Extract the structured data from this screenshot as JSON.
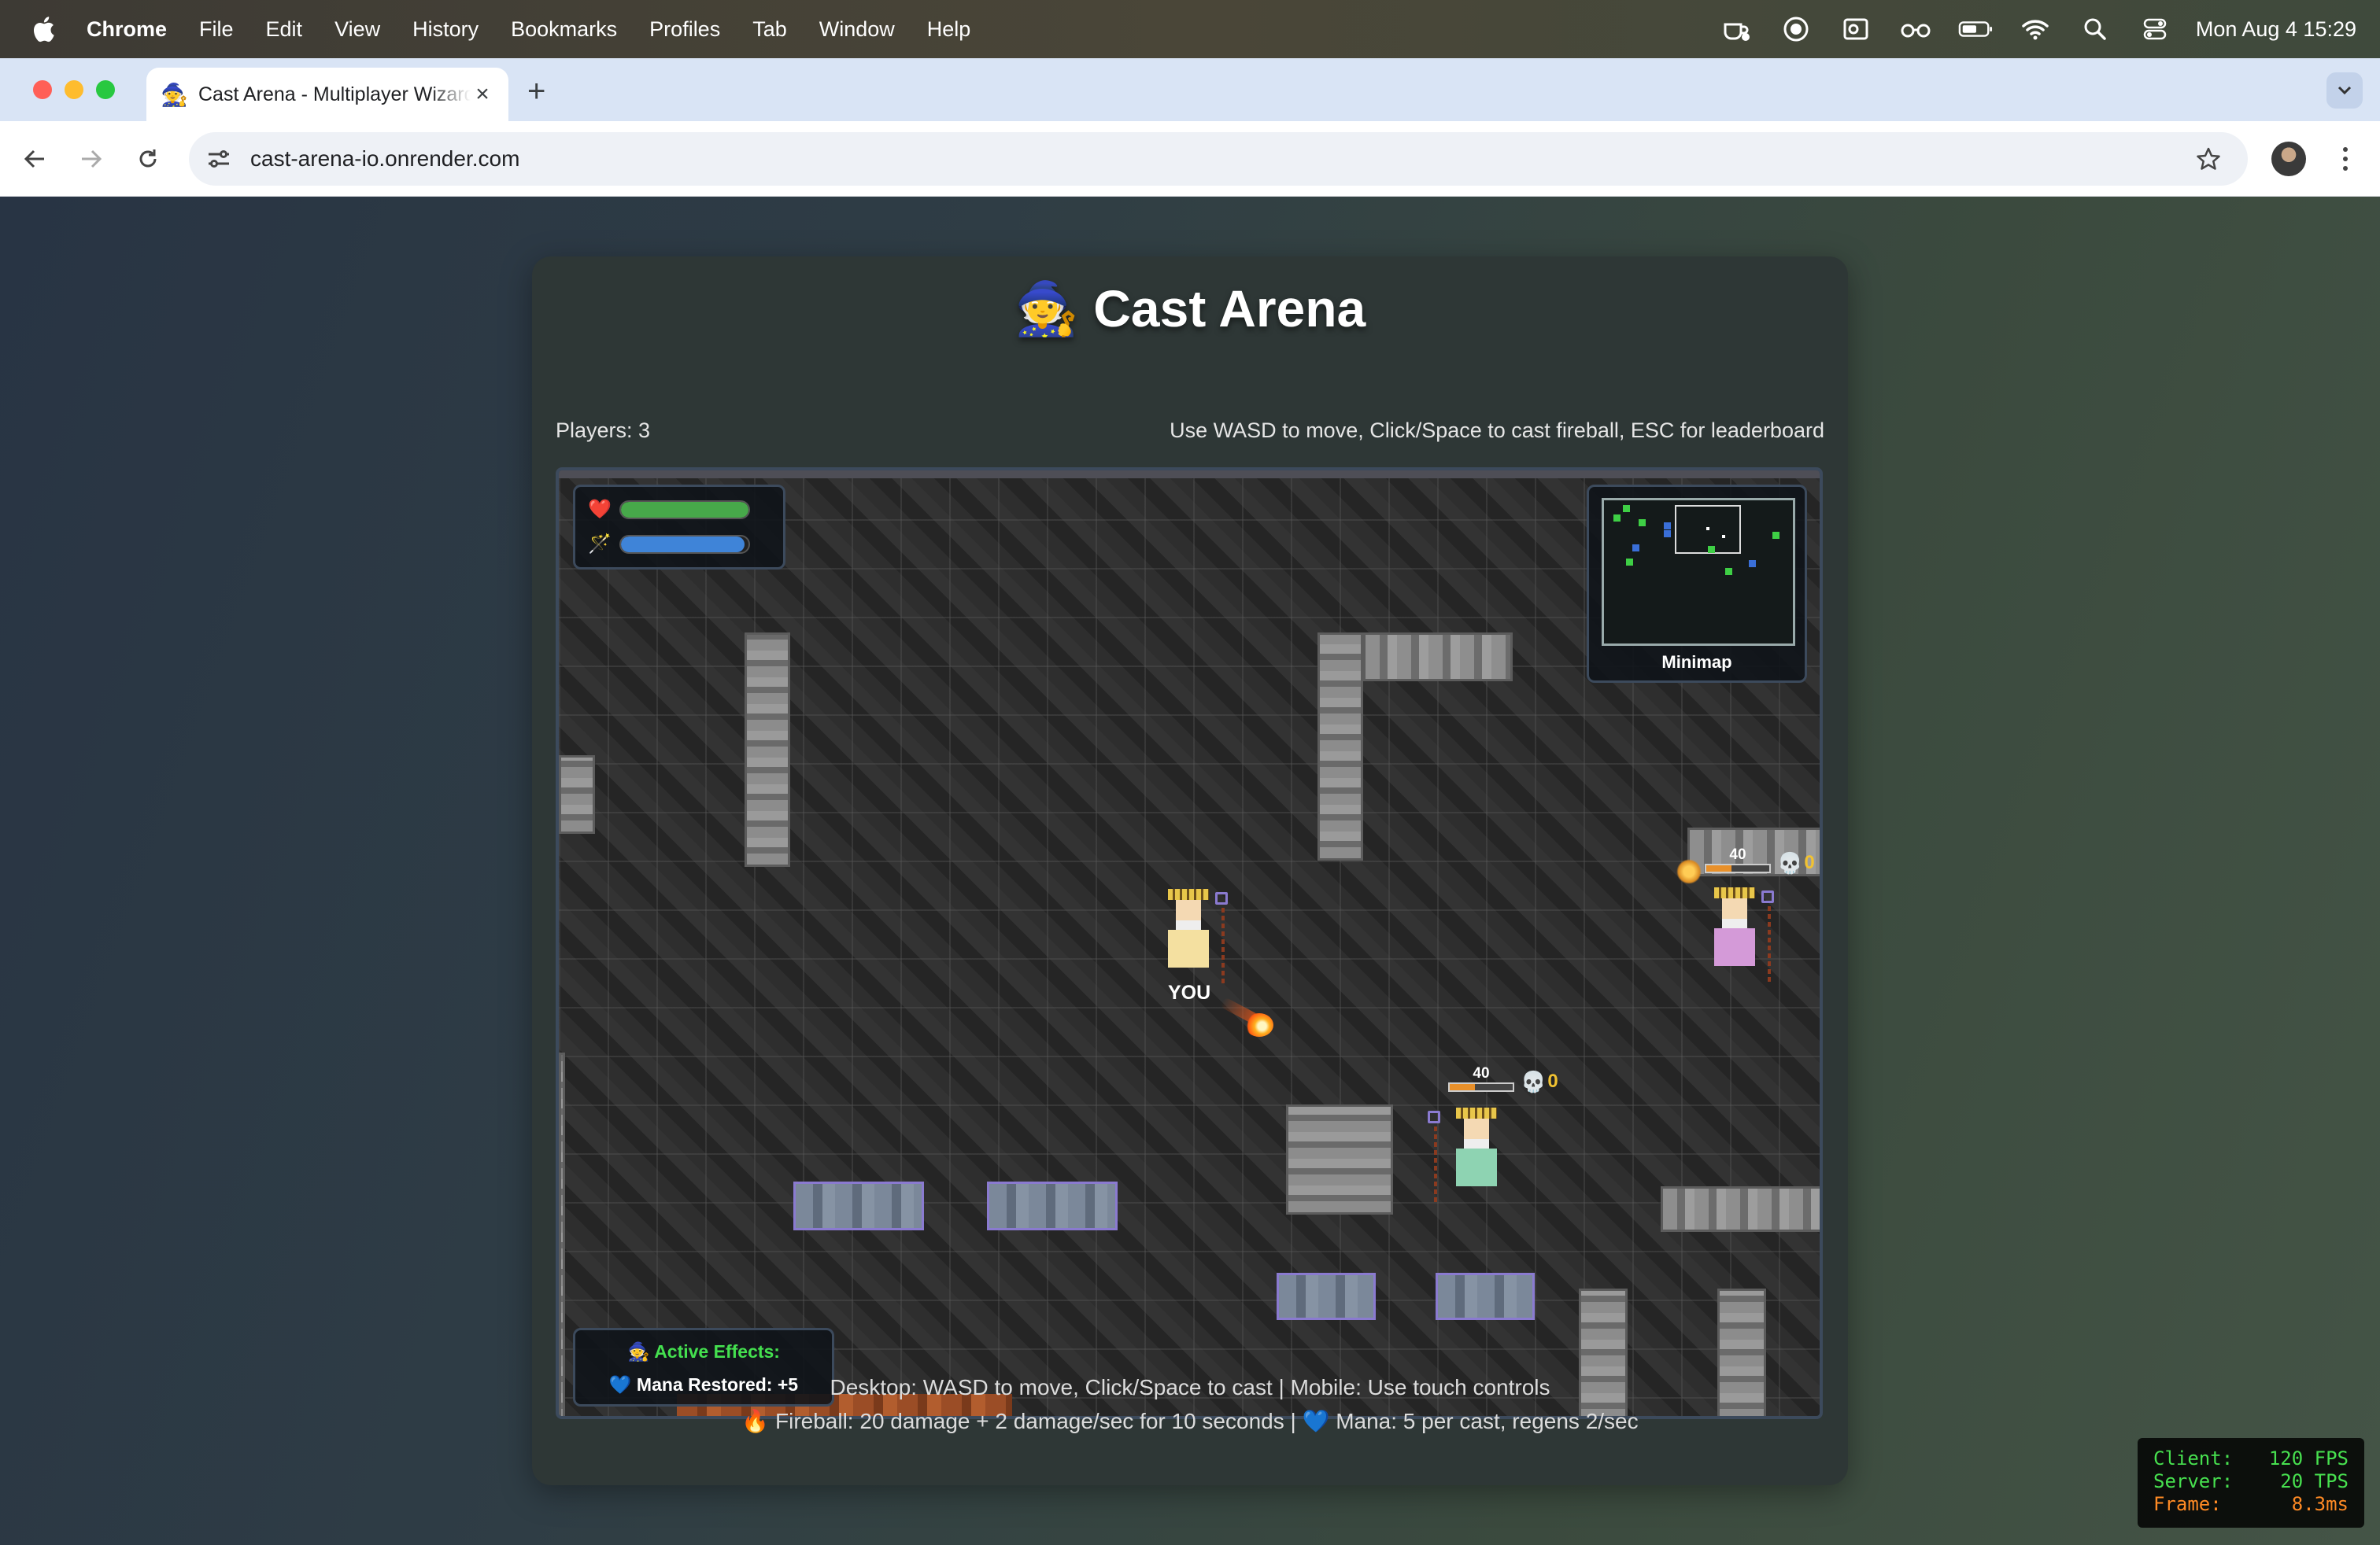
{
  "menubar": {
    "app_name": "Chrome",
    "items": [
      "File",
      "Edit",
      "View",
      "History",
      "Bookmarks",
      "Profiles",
      "Tab",
      "Window",
      "Help"
    ],
    "clock": "Mon Aug 4  15:29"
  },
  "browser": {
    "tab_title": "Cast Arena - Multiplayer Wizard",
    "tab_icon": "🧙",
    "url": "cast-arena-io.onrender.com"
  },
  "game": {
    "title": "🧙 Cast Arena",
    "players": "Players: 3",
    "hint": "Use WASD to move, Click/Space to cast fireball, ESC for leaderboard",
    "player": {
      "label": "YOU",
      "health": 1.0,
      "mana": 0.97,
      "health_icon": "❤️",
      "mana_icon": "🪄"
    },
    "minimap_label": "Minimap",
    "effects": {
      "title": "🧙 Active Effects:",
      "line": "💙 Mana Restored: +5"
    },
    "enemies": [
      {
        "hp_text": "40",
        "kills": "0",
        "skull": "💀",
        "robe_color": "#d49ad8"
      },
      {
        "hp_text": "40",
        "kills": "0",
        "skull": "💀",
        "robe_color": "#8ed3b2"
      }
    ],
    "player_robe_color": "#f4e0a0",
    "footer_line1": "Desktop: WASD to move, Click/Space to cast | Mobile: Use touch controls",
    "footer_line2": "🔥 Fireball: 20 damage + 2 damage/sec for 10 seconds | 💙 Mana: 5 per cast, regens 2/sec"
  },
  "perf": {
    "client_label": "Client:",
    "client_value": "120 FPS",
    "server_label": "Server:",
    "server_value": "20 TPS",
    "frame_label": "Frame:",
    "frame_value": "8.3ms"
  },
  "colors": {
    "health": "#47a84a",
    "mana": "#3f84d8",
    "effects_title": "#44e04f",
    "perf_green": "#47e04f",
    "perf_orange": "#ff8a24"
  }
}
